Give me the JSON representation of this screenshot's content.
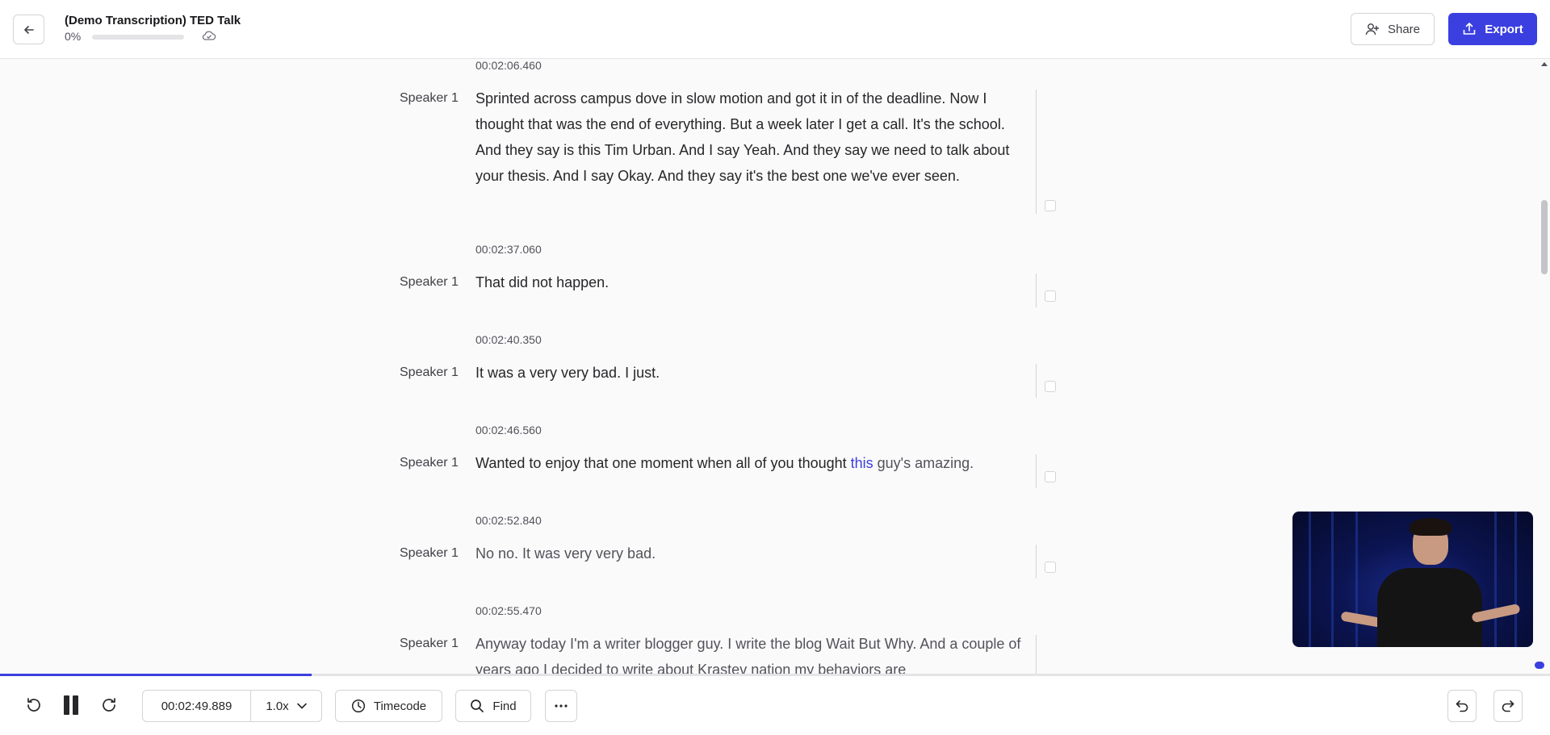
{
  "header": {
    "title": "(Demo Transcription) TED Talk",
    "progress_text": "0%",
    "share_label": "Share",
    "export_label": "Export"
  },
  "segments": [
    {
      "timestamp": "00:02:06.460",
      "speaker": "Speaker 1",
      "text": "Sprinted across campus dove in slow motion and got it in of the deadline. Now I thought that was the end of everything. But a week later I get a call. It's the school. And they say is this Tim Urban. And I say Yeah. And they say we need to talk about your thesis. And I say Okay. And they say it's the best one we've ever seen."
    },
    {
      "timestamp": "00:02:37.060",
      "speaker": "Speaker 1",
      "text": "That did not happen."
    },
    {
      "timestamp": "00:02:40.350",
      "speaker": "Speaker 1",
      "text": "It was a very very bad. I just."
    },
    {
      "timestamp": "00:02:46.560",
      "speaker": "Speaker 1",
      "text_spoken": "Wanted to enjoy that one moment when all of you thought ",
      "text_active": "this",
      "text_upcoming": " guy's amazing."
    },
    {
      "timestamp": "00:02:52.840",
      "speaker": "Speaker 1",
      "text": "No no. It was very very bad."
    },
    {
      "timestamp": "00:02:55.470",
      "speaker": "Speaker 1",
      "text": "Anyway today I'm a writer blogger guy. I write the blog Wait But Why. And a couple of years ago I decided to write about Krastev nation my behaviors are"
    }
  ],
  "player": {
    "current_time": "00:02:49.889",
    "speed": "1.0x",
    "timecode_label": "Timecode",
    "find_label": "Find",
    "played_fraction": 0.201
  },
  "colors": {
    "accent": "#3b3fe0",
    "text": "#27272a",
    "muted": "#52525b",
    "border": "#d4d4d8"
  }
}
